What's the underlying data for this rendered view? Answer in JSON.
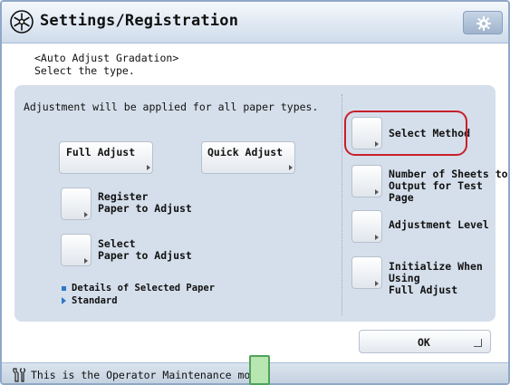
{
  "header": {
    "title": "Settings/Registration",
    "icon": "settings-registration-icon",
    "settings_button_icon": "gear-icon"
  },
  "subtitle": {
    "line1": "<Auto Adjust Gradation>",
    "line2": "Select the type."
  },
  "panel": {
    "note": "Adjustment will be applied for all paper types."
  },
  "buttons": {
    "full_adjust": "Full Adjust",
    "quick_adjust": "Quick Adjust",
    "register_paper": [
      "Register",
      "Paper to Adjust"
    ],
    "select_paper": [
      "Select",
      "Paper to Adjust"
    ]
  },
  "details": {
    "label": "Details of Selected Paper",
    "value": "Standard"
  },
  "right_options": [
    {
      "lines": [
        "Select Method"
      ]
    },
    {
      "lines": [
        "Number of Sheets to",
        "Output for Test Page"
      ]
    },
    {
      "lines": [
        "Adjustment Level"
      ]
    },
    {
      "lines": [
        "Initialize When Using",
        "Full Adjust"
      ]
    }
  ],
  "ok_label": "OK",
  "status": {
    "text": "This is the Operator Maintenance mode.",
    "icon": "wrench-icon"
  },
  "colors": {
    "highlight": "#c8202a",
    "panel": "#d5dfeb",
    "accent": "#2a79c9",
    "status_led": "#4fa35a"
  }
}
